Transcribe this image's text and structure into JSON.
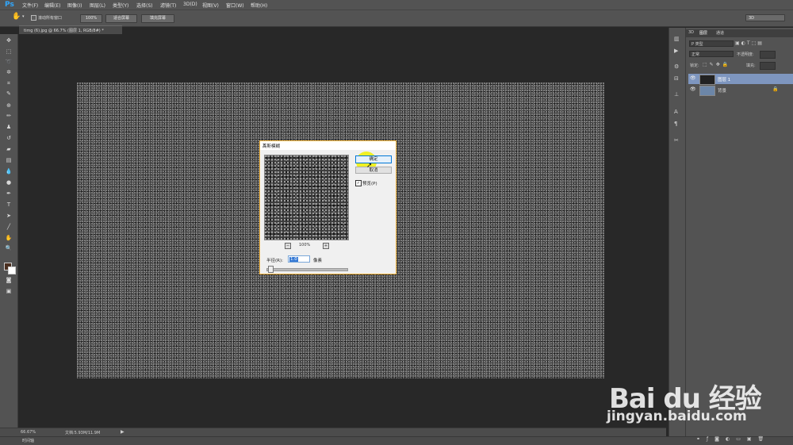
{
  "app": {
    "logo": "Ps"
  },
  "menu": [
    "文件(F)",
    "编辑(E)",
    "图像(I)",
    "图层(L)",
    "类型(Y)",
    "选择(S)",
    "滤镜(T)",
    "3D(D)",
    "视图(V)",
    "窗口(W)",
    "帮助(H)"
  ],
  "options": {
    "scroll_all": "滚动所有窗口",
    "zoom": "100%",
    "fit_screen": "适合屏幕",
    "fill_screen": "填充屏幕",
    "workspace": "3D"
  },
  "document": {
    "tab_title": "timg (6).jpg @ 66.7% (图层 1, RGB/8#) *"
  },
  "status": {
    "zoom": "66.67%",
    "doc_size": "文档:5.93M/11.9M",
    "timeline": "时间轴"
  },
  "layers_panel": {
    "tabs": [
      "3D",
      "图层",
      "通道"
    ],
    "kind": "P 类型",
    "blend_mode": "正常",
    "opacity_label": "不透明度:",
    "lock_label": "锁定:",
    "fill_label": "填充:",
    "layers": [
      {
        "name": "图层 1"
      },
      {
        "name": "背景"
      }
    ]
  },
  "dialog": {
    "title": "高斯模糊",
    "ok": "确定",
    "cancel": "取消",
    "preview": "预览(P)",
    "zoom": "100%",
    "radius_label": "半径(R):",
    "radius_value": "1.0",
    "radius_unit": "像素",
    "zoom_out": "−",
    "zoom_in": "+"
  },
  "watermark": {
    "brand": "Bai du 经验",
    "site": "jingyan.baidu.com"
  }
}
